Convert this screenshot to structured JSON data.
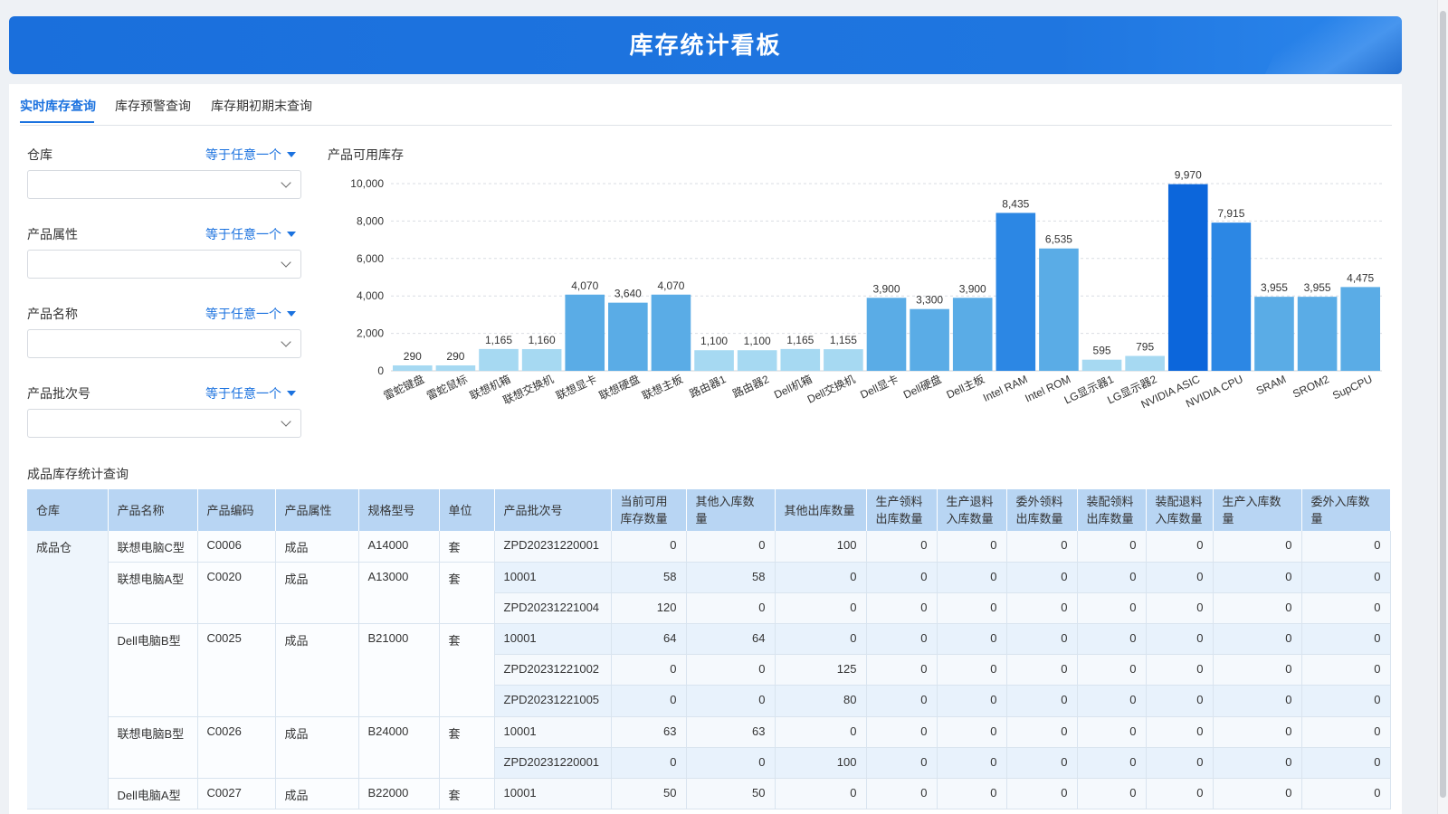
{
  "header": {
    "title": "库存统计看板"
  },
  "tabs": [
    {
      "label": "实时库存查询",
      "active": true
    },
    {
      "label": "库存预警查询",
      "active": false
    },
    {
      "label": "库存期初期末查询",
      "active": false
    }
  ],
  "filters": [
    {
      "label": "仓库",
      "operator": "等于任意一个",
      "value": ""
    },
    {
      "label": "产品属性",
      "operator": "等于任意一个",
      "value": ""
    },
    {
      "label": "产品名称",
      "operator": "等于任意一个",
      "value": ""
    },
    {
      "label": "产品批次号",
      "operator": "等于任意一个",
      "value": ""
    }
  ],
  "chart": {
    "title": "产品可用库存"
  },
  "chart_data": {
    "type": "bar",
    "title": "产品可用库存",
    "categories": [
      "雷蛇键盘",
      "雷蛇鼠标",
      "联想机箱",
      "联想交换机",
      "联想显卡",
      "联想硬盘",
      "联想主板",
      "路由器1",
      "路由器2",
      "Dell机箱",
      "Dell交换机",
      "Dell显卡",
      "Dell硬盘",
      "Dell主板",
      "Intel RAM",
      "Intel ROM",
      "LG显示器1",
      "LG显示器2",
      "NVIDIA ASIC",
      "NVIDIA CPU",
      "SRAM",
      "SROM2",
      "SupCPU"
    ],
    "values": [
      290,
      290,
      1165,
      1160,
      4070,
      3640,
      4070,
      1100,
      1100,
      1165,
      1155,
      3900,
      3300,
      3900,
      8435,
      6535,
      595,
      795,
      9970,
      7915,
      3955,
      3955,
      4475
    ],
    "value_labels": [
      "290",
      "290",
      "1,165",
      "1,160",
      "4,070",
      "3,640",
      "4,070",
      "1,100",
      "1,100",
      "1,165",
      "1,155",
      "3,900",
      "3,300",
      "3,900",
      "8,435",
      "6,535",
      "595",
      "795",
      "9,970",
      "7,915",
      "3,955",
      "3,955",
      "4,475"
    ],
    "yticks": [
      "0",
      "2,000",
      "4,000",
      "6,000",
      "8,000",
      "10,000"
    ],
    "ylim": [
      0,
      10000
    ],
    "grid": true,
    "colors": {
      "low": "#a6d9f2",
      "mid": "#5aace6",
      "high": "#2c87e4",
      "max": "#0c66db"
    }
  },
  "table": {
    "title": "成品库存统计查询",
    "columns": [
      "仓库",
      "产品名称",
      "产品编码",
      "产品属性",
      "规格型号",
      "单位",
      "产品批次号",
      "当前可用库存数量",
      "其他入库数量",
      "其他出库数量",
      "生产领料出库数量",
      "生产退料入库数量",
      "委外领料出库数量",
      "装配领料出库数量",
      "装配退料入库数量",
      "生产入库数量",
      "委外入库数量"
    ],
    "warehouse": "成品仓",
    "groups": [
      {
        "name": "联想电脑C型",
        "code": "C0006",
        "attr": "成品",
        "spec": "A14000",
        "unit": "套",
        "batches": [
          {
            "batch": "ZPD20231220001",
            "v": [
              "0",
              "0",
              "100",
              "0",
              "0",
              "0",
              "0",
              "0",
              "0",
              "0"
            ]
          }
        ]
      },
      {
        "name": "联想电脑A型",
        "code": "C0020",
        "attr": "成品",
        "spec": "A13000",
        "unit": "套",
        "batches": [
          {
            "batch": "10001",
            "v": [
              "58",
              "58",
              "0",
              "0",
              "0",
              "0",
              "0",
              "0",
              "0",
              "0"
            ]
          },
          {
            "batch": "ZPD20231221004",
            "v": [
              "120",
              "0",
              "0",
              "0",
              "0",
              "0",
              "0",
              "0",
              "0",
              "0"
            ]
          }
        ]
      },
      {
        "name": "Dell电脑B型",
        "code": "C0025",
        "attr": "成品",
        "spec": "B21000",
        "unit": "套",
        "batches": [
          {
            "batch": "10001",
            "v": [
              "64",
              "64",
              "0",
              "0",
              "0",
              "0",
              "0",
              "0",
              "0",
              "0"
            ]
          },
          {
            "batch": "ZPD20231221002",
            "v": [
              "0",
              "0",
              "125",
              "0",
              "0",
              "0",
              "0",
              "0",
              "0",
              "0"
            ]
          },
          {
            "batch": "ZPD20231221005",
            "v": [
              "0",
              "0",
              "80",
              "0",
              "0",
              "0",
              "0",
              "0",
              "0",
              "0"
            ]
          }
        ]
      },
      {
        "name": "联想电脑B型",
        "code": "C0026",
        "attr": "成品",
        "spec": "B24000",
        "unit": "套",
        "batches": [
          {
            "batch": "10001",
            "v": [
              "63",
              "63",
              "0",
              "0",
              "0",
              "0",
              "0",
              "0",
              "0",
              "0"
            ]
          },
          {
            "batch": "ZPD20231220001",
            "v": [
              "0",
              "0",
              "100",
              "0",
              "0",
              "0",
              "0",
              "0",
              "0",
              "0"
            ]
          }
        ]
      },
      {
        "name": "Dell电脑A型",
        "code": "C0027",
        "attr": "成品",
        "spec": "B22000",
        "unit": "套",
        "batches": [
          {
            "batch": "10001",
            "v": [
              "50",
              "50",
              "0",
              "0",
              "0",
              "0",
              "0",
              "0",
              "0",
              "0"
            ]
          }
        ]
      }
    ]
  }
}
